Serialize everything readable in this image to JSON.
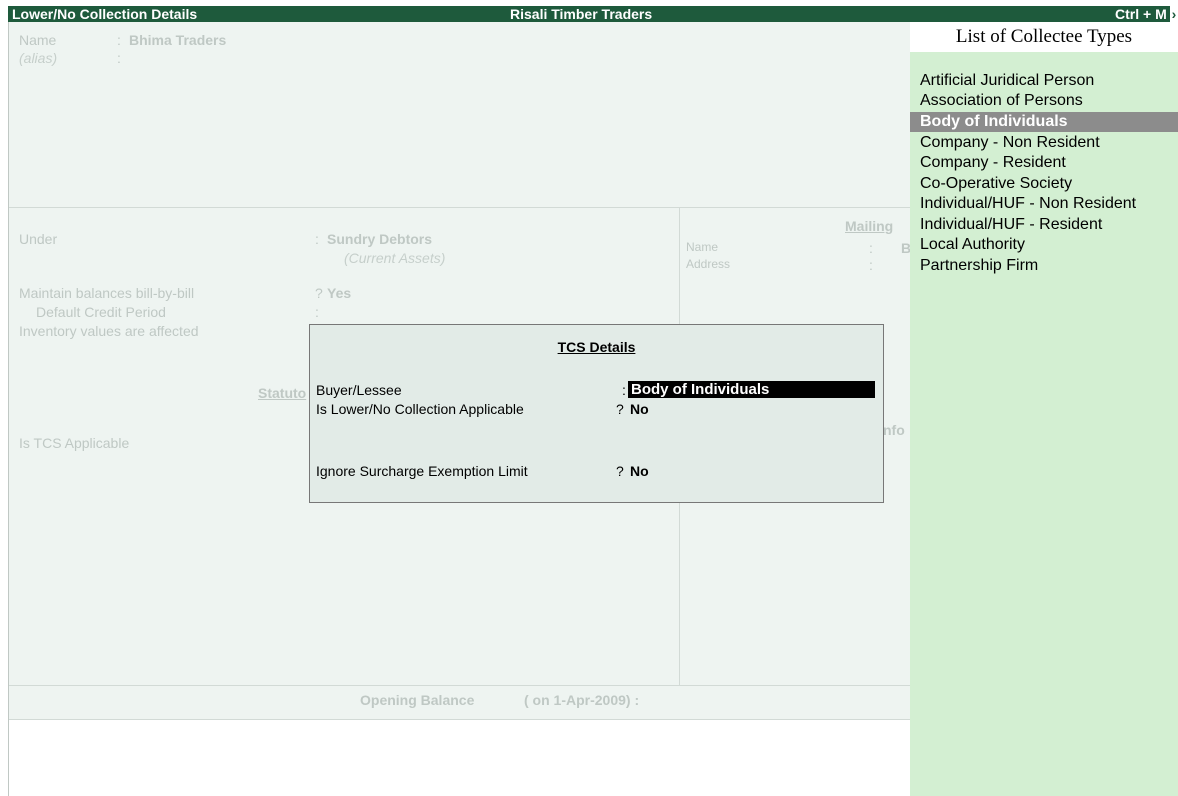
{
  "titlebar": {
    "left": "Lower/No Collection Details",
    "center": "Risali Timber Traders",
    "right": "Ctrl + M"
  },
  "form": {
    "name_label": "Name",
    "name_value": "Bhima Traders",
    "alias_label": "(alias)",
    "under_label": "Under",
    "under_value": "Sundry Debtors",
    "under_sub": "(Current Assets)",
    "maintain_label": "Maintain balances bill-by-bill",
    "maintain_value": "Yes",
    "credit_label": "Default Credit Period",
    "inventory_label": "Inventory values are affected",
    "statutory_heading": "Statuto",
    "tcs_label": "Is TCS Applicable",
    "mailing_heading": "Mailing",
    "mail_name_label": "Name",
    "mail_name_value": "B",
    "mail_address_label": "Address",
    "info_heading": "nfo",
    "opening_label": "Opening Balance",
    "opening_date": "( on 1-Apr-2009) :"
  },
  "dialog": {
    "title": "TCS Details",
    "buyer_label": "Buyer/Lessee",
    "buyer_value": "Body of Individuals",
    "lower_label": "Is Lower/No Collection Applicable",
    "lower_value": "No",
    "ignore_label": "Ignore Surcharge Exemption Limit",
    "ignore_value": "No"
  },
  "side_list": {
    "title": "List of Collectee Types",
    "items": [
      "Artificial Juridical Person",
      "Association of Persons",
      "Body of Individuals",
      "Company - Non Resident",
      "Company - Resident",
      "Co-Operative Society",
      "Individual/HUF - Non Resident",
      "Individual/HUF - Resident",
      "Local Authority",
      "Partnership Firm"
    ],
    "selected": "Body of Individuals"
  },
  "colors": {
    "titlebar_bg": "#1e5a3c",
    "form_bg": "#eef4f1",
    "list_bg": "#d3efd2",
    "selection_bg": "#8c8c8c"
  }
}
